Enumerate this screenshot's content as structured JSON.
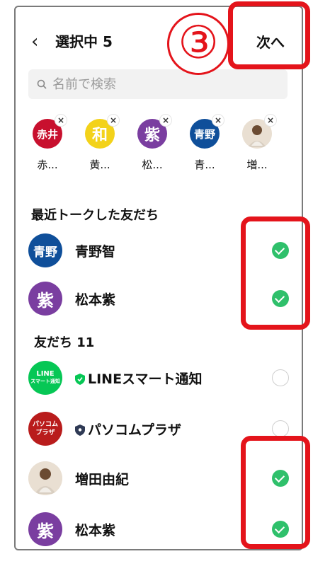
{
  "header": {
    "back_icon": "‹",
    "title": "選択中 5",
    "next_label": "次へ"
  },
  "search": {
    "placeholder": "名前で検索"
  },
  "selected": [
    {
      "avatar_text": "赤井",
      "color": "#c8102e",
      "name": "赤..."
    },
    {
      "avatar_text": "和",
      "color": "#f3d21a",
      "name": "黄..."
    },
    {
      "avatar_text": "紫",
      "color": "#7a3ea0",
      "name": "松..."
    },
    {
      "avatar_text": "青野",
      "color": "#0f4f9a",
      "name": "青..."
    },
    {
      "avatar_text": "",
      "color": "#c9b8a6",
      "name": "増..."
    }
  ],
  "sections": {
    "recent": "最近トークした友だち",
    "friends": "友だち 11"
  },
  "recent_items": [
    {
      "avatar_text": "青野",
      "color": "#0f4f9a",
      "name": "青野智",
      "checked": true
    },
    {
      "avatar_text": "紫",
      "color": "#7a3ea0",
      "name": "松本紫",
      "checked": true
    }
  ],
  "friend_items": [
    {
      "avatar_text": "LINE",
      "avatar_sub": "スマート通知",
      "color": "#06c755",
      "name": "LINEスマート通知",
      "badge": "green-shield",
      "checked": false
    },
    {
      "avatar_text": "パソコム",
      "avatar_sub": "プラザ",
      "color": "#b91c1c",
      "name": "パソコムプラザ",
      "badge": "navy-shield",
      "checked": false
    },
    {
      "avatar_text": "",
      "color": "#c9b8a6",
      "name": "増田由紀",
      "checked": true
    },
    {
      "avatar_text": "紫",
      "color": "#7a3ea0",
      "name": "松本紫",
      "checked": true
    }
  ],
  "annotation": {
    "step_number": "③"
  },
  "colors": {
    "accent_check": "#2fc06b",
    "callout_red": "#e4141b"
  }
}
